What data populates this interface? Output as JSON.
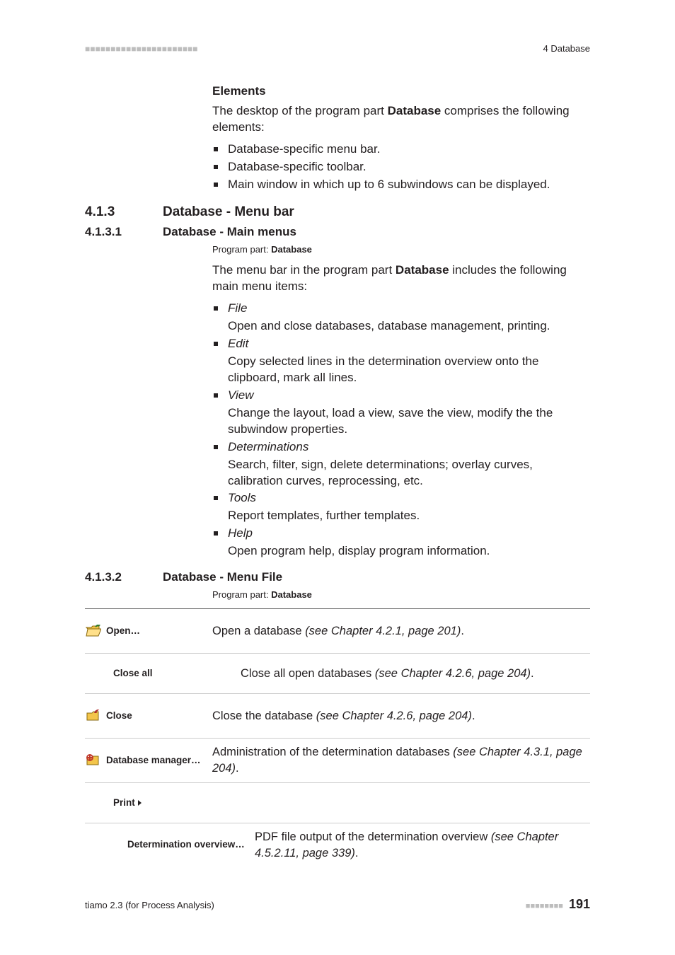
{
  "header": {
    "left_dots": "■■■■■■■■■■■■■■■■■■■■■■",
    "right": "4 Database"
  },
  "elements": {
    "heading": "Elements",
    "intro_pre": "The desktop of the program part ",
    "intro_bold": "Database",
    "intro_post": " comprises the following elements:",
    "items": [
      "Database-specific menu bar.",
      "Database-specific toolbar.",
      "Main window in which up to 6 subwindows can be displayed."
    ]
  },
  "sec413": {
    "num": "4.1.3",
    "title": "Database - Menu bar"
  },
  "sec4131": {
    "num": "4.1.3.1",
    "title": "Database - Main menus",
    "program_part_label": "Program part: ",
    "program_part_value": "Database",
    "intro_pre": "The menu bar in the program part ",
    "intro_bold": "Database",
    "intro_post": " includes the following main menu items:",
    "menus": [
      {
        "name": "File",
        "desc": "Open and close databases, database management, printing."
      },
      {
        "name": "Edit",
        "desc": "Copy selected lines in the determination overview onto the clipboard, mark all lines."
      },
      {
        "name": "View",
        "desc": "Change the layout, load a view, save the view, modify the the subwindow properties."
      },
      {
        "name": "Determinations",
        "desc": "Search, filter, sign, delete determinations; overlay curves, calibration curves, reprocessing, etc."
      },
      {
        "name": "Tools",
        "desc": "Report templates, further templates."
      },
      {
        "name": "Help",
        "desc": "Open program help, display program information."
      }
    ]
  },
  "sec4132": {
    "num": "4.1.3.2",
    "title": "Database - Menu File",
    "program_part_label": "Program part: ",
    "program_part_value": "Database"
  },
  "table": {
    "rows": [
      {
        "icon": "open-folder-icon",
        "label": "Open…",
        "desc_pre": "Open a database ",
        "desc_ref": "(see Chapter 4.2.1, page 201)",
        "desc_post": "."
      },
      {
        "icon": "",
        "indent": 1,
        "label": "Close all",
        "desc_pre": "Close all open databases ",
        "desc_ref": "(see Chapter 4.2.6, page 204)",
        "desc_post": "."
      },
      {
        "icon": "close-folder-icon",
        "label": "Close",
        "desc_pre": "Close the database ",
        "desc_ref": "(see Chapter 4.2.6, page 204)",
        "desc_post": "."
      },
      {
        "icon": "db-manager-icon",
        "label": "Database manager…",
        "desc_pre": "Administration of the determination databases ",
        "desc_ref": "(see Chapter 4.3.1, page 204)",
        "desc_post": "."
      },
      {
        "icon": "",
        "indent": 1,
        "label": "Print",
        "submenu": true,
        "desc_pre": "",
        "desc_ref": "",
        "desc_post": ""
      },
      {
        "icon": "",
        "indent": 2,
        "label": "Determination overview…",
        "desc_pre": "PDF file output of the determination overview ",
        "desc_ref": "(see Chapter 4.5.2.11, page 339)",
        "desc_post": "."
      }
    ]
  },
  "footer": {
    "left": "tiamo 2.3 (for Process Analysis)",
    "dots": "■■■■■■■■",
    "page": "191"
  }
}
